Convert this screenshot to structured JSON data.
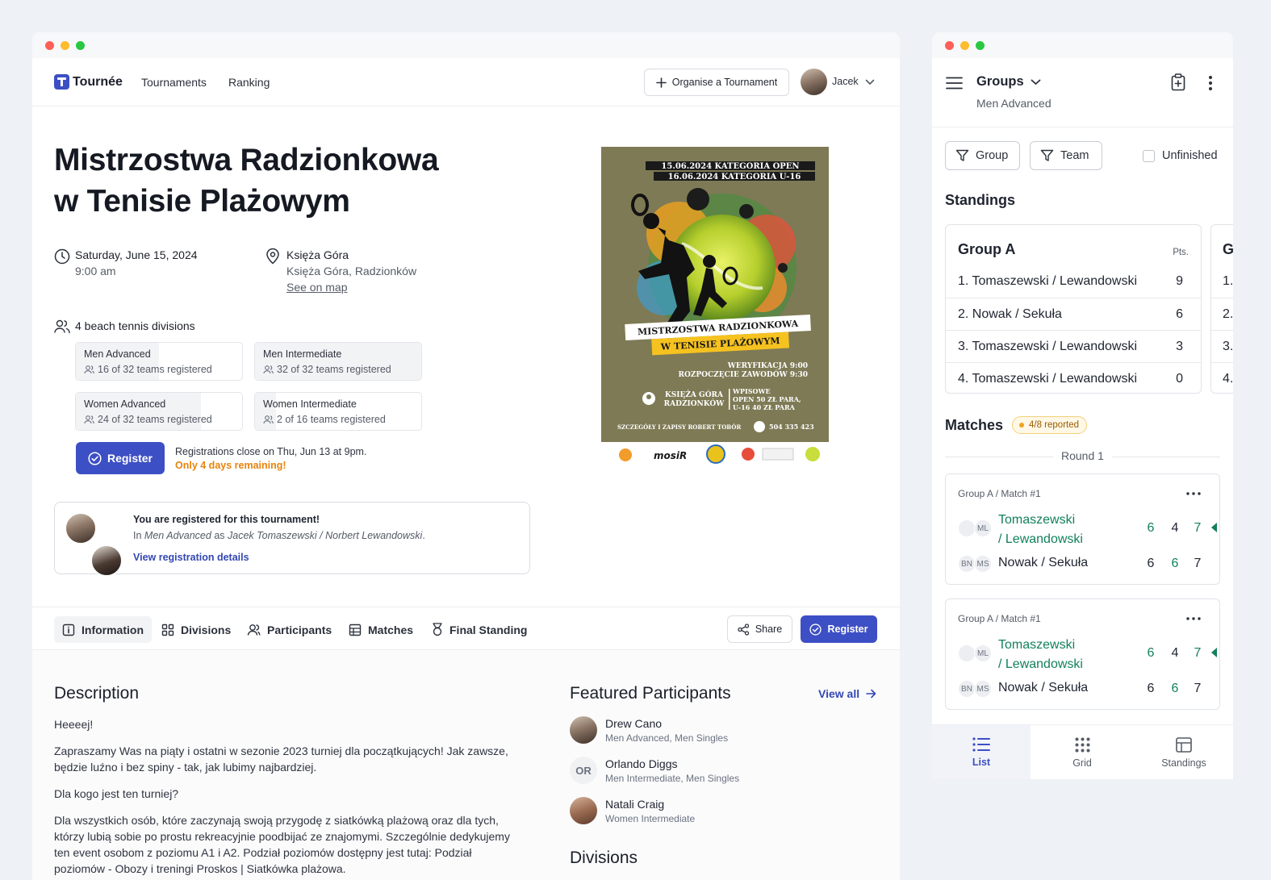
{
  "app": {
    "name": "Tournée"
  },
  "nav": {
    "links": [
      "Tournaments",
      "Ranking"
    ],
    "organise_label": "Organise a Tournament",
    "user_name": "Jacek"
  },
  "tournament": {
    "title_line1": "Mistrzostwa Radzionkowa",
    "title_line2": "w Tenisie Plażowym",
    "date": "Saturday, June 15, 2024",
    "time": "9:00 am",
    "venue_name": "Księża Góra",
    "venue_address": "Księża Góra, Radzionków",
    "map_link": "See on map",
    "divisions_summary": "4 beach tennis divisions",
    "divisions": [
      {
        "name": "Men Advanced",
        "registered": "16 of 32 teams registered",
        "fill": 0.5
      },
      {
        "name": "Men Intermediate",
        "registered": "32 of 32 teams registered",
        "fill": 1.0
      },
      {
        "name": "Women Advanced",
        "registered": "24 of 32 teams registered",
        "fill": 0.75
      },
      {
        "name": "Women Intermediate",
        "registered": "2 of 16 teams registered",
        "fill": 0.125
      }
    ],
    "register_label": "Register",
    "reg_close": "Registrations close on Thu, Jun 13 at 9pm.",
    "reg_remaining": "Only 4 days remaining!"
  },
  "poster": {
    "line1": "15.06.2024 KATEGORIA OPEN",
    "line2": "16.06.2024 KATEGORIA U-16",
    "banner1": "MISTRZOSTWA RADZIONKOWA",
    "banner2": "W TENISIE PLAŻOWYM",
    "check1": "WERYFIKACJA 9:00",
    "check2": "ROZPOCZĘCIE ZAWODÓW 9:30",
    "place1": "KSIĘŻA GÓRA",
    "place2": "RADZIONKÓW",
    "fee1": "WPISOWE",
    "fee2": "OPEN 50 ZŁ PARA,",
    "fee3": "U-16 40 ZŁ PARA",
    "contact": "SZCZEGÓŁY I ZAPISY ROBERT TOBÓR",
    "phone": "504 335 423",
    "sponsor": "mosiR"
  },
  "registration_notice": {
    "heading": "You are registered for this tournament!",
    "prefix": "In ",
    "division": "Men Advanced",
    "as": " as ",
    "team": "Jacek Tomaszewski / Norbert Lewandowski",
    "suffix": ".",
    "link": "View registration details"
  },
  "tabs": [
    "Information",
    "Divisions",
    "Participants",
    "Matches",
    "Final Standing"
  ],
  "actions": {
    "share": "Share",
    "register": "Register"
  },
  "description": {
    "heading": "Description",
    "paragraphs": [
      "Heeeej!",
      "Zapraszamy Was na piąty i ostatni w sezonie 2023 turniej dla początkujących! Jak zawsze, będzie luźno i bez spiny - tak, jak lubimy najbardziej.",
      "Dla kogo jest ten turniej?",
      "Dla wszystkich osób, które zaczynają swoją przygodę z siatkówką plażową oraz dla tych, którzy lubią sobie po prostu rekreacyjnie poodbijać ze znajomymi. Szczególnie dedykujemy ten event osobom z poziomu A1 i A2. Podział poziomów dostępny jest tutaj: Podział poziomów - Obozy i treningi Proskos | Siatkówka plażowa."
    ]
  },
  "featured": {
    "heading": "Featured Participants",
    "view_all": "View all",
    "participants": [
      {
        "name": "Drew Cano",
        "divisions": "Men Advanced, Men Singles",
        "initials": ""
      },
      {
        "name": "Orlando Diggs",
        "divisions": "Men Intermediate, Men Singles",
        "initials": "OR"
      },
      {
        "name": "Natali Craig",
        "divisions": "Women Intermediate",
        "initials": ""
      }
    ],
    "divisions_heading": "Divisions"
  },
  "side": {
    "title": "Groups",
    "subtitle": "Men Advanced",
    "filters": {
      "group": "Group",
      "team": "Team",
      "unfinished": "Unfinished"
    },
    "standings_heading": "Standings",
    "group_a": {
      "name": "Group A",
      "pts_label": "Pts.",
      "rows": [
        {
          "team": "1. Tomaszewski / Lewandowski",
          "pts": "9"
        },
        {
          "team": "2. Nowak / Sekuła",
          "pts": "6"
        },
        {
          "team": "3. Tomaszewski / Lewandowski",
          "pts": "3"
        },
        {
          "team": "4. Tomaszewski / Lewandowski",
          "pts": "0"
        }
      ]
    },
    "group_b_partial": {
      "name": "G",
      "rows": [
        "1.",
        "2.",
        "3.",
        "4."
      ]
    },
    "matches_heading": "Matches",
    "reported": "4/8 reported",
    "round": "Round 1",
    "matches": [
      {
        "label": "Group A / Match #1",
        "team1_line1": "Tomaszewski",
        "team1_line2": "/ Lewandowski",
        "team1_initials": "ML",
        "team1_scores": [
          "6",
          "4",
          "7"
        ],
        "team2": "Nowak / Sekuła",
        "team2_initials1": "BN",
        "team2_initials2": "MS",
        "team2_scores": [
          "6",
          "6",
          "7"
        ]
      },
      {
        "label": "Group A / Match #1",
        "team1_line1": "Tomaszewski",
        "team1_line2": "/ Lewandowski",
        "team1_initials": "ML",
        "team1_scores": [
          "6",
          "4",
          "7"
        ],
        "team2": "Nowak / Sekuła",
        "team2_initials1": "BN",
        "team2_initials2": "MS",
        "team2_scores": [
          "6",
          "6",
          "7"
        ]
      }
    ],
    "bottom_nav": [
      "List",
      "Grid",
      "Standings"
    ]
  },
  "colors": {
    "accent": "#3d4fc4",
    "win": "#12805c",
    "warning": "#e8830c",
    "poster_bg": "#7e7a55"
  }
}
